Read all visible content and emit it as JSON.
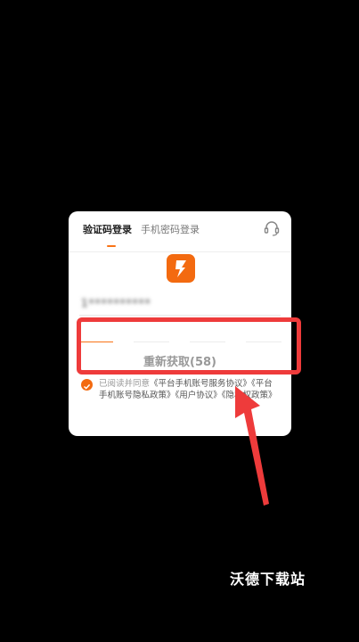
{
  "tabs": [
    {
      "label": "验证码登录",
      "active": true
    },
    {
      "label": "手机密码登录",
      "active": false
    }
  ],
  "icons": {
    "support": "headset-icon",
    "logo": "lightning-logo-icon",
    "checkbox": "check-icon"
  },
  "phone": {
    "value": "1**********"
  },
  "code": {
    "cells": 4
  },
  "resend": {
    "label": "重新获取(58)"
  },
  "agreement": {
    "prefix": "已阅读并同意",
    "text": "《平台手机账号服务协议》《平台手机账号隐私政策》《用户协议》《隐私权政策》"
  },
  "watermark": "沃德下载站",
  "colors": {
    "accent": "#f36a10",
    "highlight": "#ee3b3b"
  }
}
